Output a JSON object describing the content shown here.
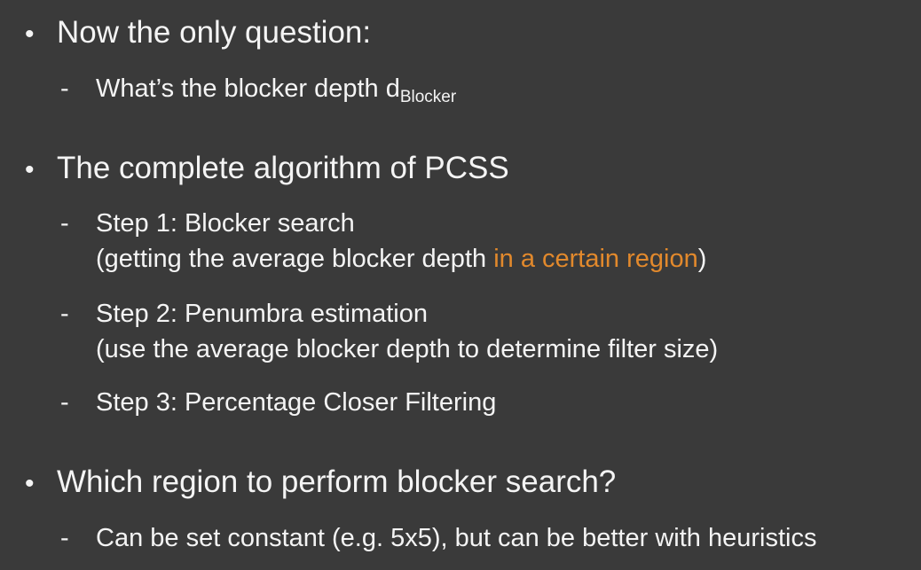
{
  "colors": {
    "background": "#3a3a3a",
    "text": "#f4f4f4",
    "accent": "#e2892c"
  },
  "bullet_glyph": "•",
  "dash_glyph": "-",
  "sections": [
    {
      "heading": "Now the only question:",
      "items": [
        {
          "text": "What’s the blocker depth d",
          "subscript": "Blocker"
        }
      ]
    },
    {
      "heading": "The complete algorithm of PCSS",
      "items": [
        {
          "line1": "Step 1: Blocker search",
          "line2_before": "(getting the average blocker depth ",
          "line2_highlight": "in a certain region",
          "line2_after": ")"
        },
        {
          "line1": "Step 2: Penumbra estimation",
          "line2": "(use the average blocker depth to determine filter size)"
        },
        {
          "line1": "Step 3: Percentage Closer Filtering"
        }
      ]
    },
    {
      "heading": "Which region to perform blocker search?",
      "items": [
        {
          "text": "Can be set constant (e.g. 5x5), but can be better with heuristics"
        }
      ]
    }
  ]
}
